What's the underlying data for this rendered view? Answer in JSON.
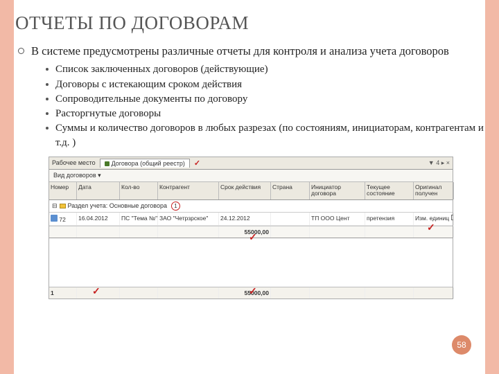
{
  "title": "ОТЧЕТЫ ПО ДОГОВОРАМ",
  "main": "В системе предусмотрены различные отчеты для контроля и анализа учета договоров",
  "subs": [
    "Список заключенных договоров (действующие)",
    "Договоры с истекающим сроком действия",
    "Сопроводительные документы по договору",
    "Расторгнутые договоры",
    "Суммы и количество договоров в любых разрезах (по состояниям, инициаторам, контрагентам и т.д. )"
  ],
  "shot": {
    "workspace": "Рабочее место",
    "tab": "Договора (общий реестр)",
    "tabright": "▼ 4 ▸ ×",
    "view": "Вид договоров",
    "headers": [
      "Номер",
      "Дата",
      "Кол-во",
      "Контрагент",
      "Срок действия",
      "Страна",
      "Инициатор договора",
      "Текущее состояние",
      "Оригинал получен"
    ],
    "group": "Раздел учета: Основные договора",
    "groupcount": "1",
    "row": {
      "n": "72",
      "date": "16.04.2012",
      "qty": "ПС \"Тема №\"",
      "ka": "ЗАО \"Четрзрское\"",
      "srok": "24.12.2012",
      "str": "",
      "init": "ТП ООО Цент",
      "st": "претензия",
      "orig": "Изм. единиц"
    },
    "sum": "55000,00",
    "footn": "1",
    "footsum": "55000,00"
  },
  "page": "58"
}
